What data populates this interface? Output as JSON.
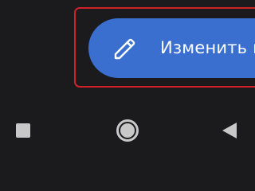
{
  "edit_fab": {
    "label": "Изменить к",
    "icon": "pencil-icon",
    "color": "#3a6fd0"
  },
  "highlight": {
    "color": "#d0202a"
  },
  "nav_bar": {
    "recents_icon": "square-icon",
    "home_icon": "circle-icon",
    "back_icon": "triangle-back-icon",
    "icon_color": "#c8c8c8"
  },
  "background_color": "#1b1b1d"
}
